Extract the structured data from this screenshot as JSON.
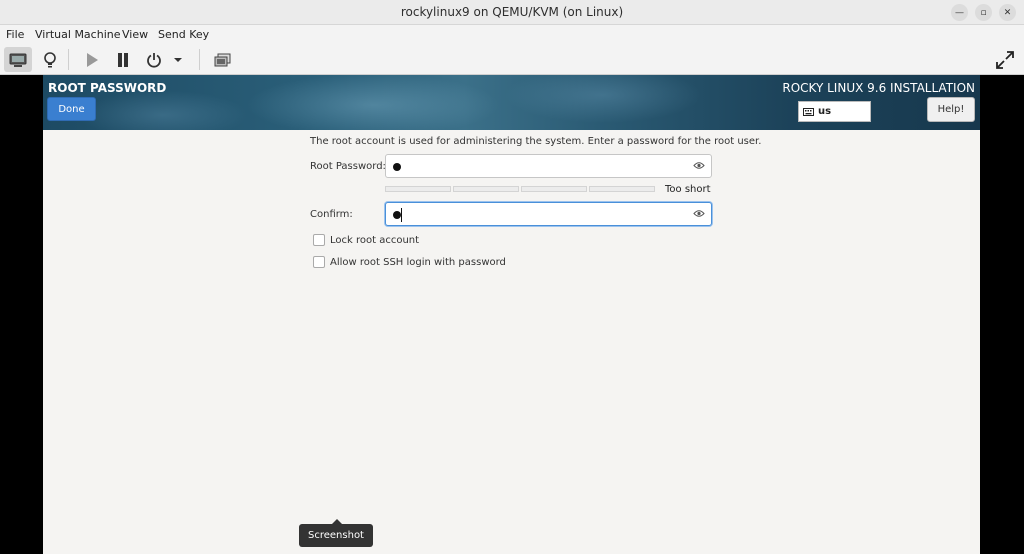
{
  "window": {
    "title": "rockylinux9 on QEMU/KVM (on Linux)"
  },
  "menu": {
    "items": [
      "File",
      "Virtual Machine",
      "View",
      "Send Key"
    ]
  },
  "toolbar": {
    "icons": [
      "console-icon",
      "details-icon",
      "run-icon",
      "pause-icon",
      "power-icon",
      "power-menu-chevron-icon",
      "snapshots-icon",
      "fullscreen-icon"
    ]
  },
  "installer": {
    "spoke_title": "ROOT PASSWORD",
    "done_label": "Done",
    "product_title": "ROCKY LINUX 9.6 INSTALLATION",
    "keyboard_layout": "us",
    "help_label": "Help!",
    "description": "The root account is used for administering the system.  Enter a password for the root user.",
    "root_password_label": "Root Password:",
    "confirm_label": "Confirm:",
    "strength_text": "Too short",
    "lock_root_label": "Lock root account",
    "ssh_login_label": "Allow root SSH login with password"
  },
  "tooltip": {
    "text": "Screenshot"
  },
  "colors": {
    "accent": "#3a7fd0",
    "focus": "#4a90d9"
  }
}
